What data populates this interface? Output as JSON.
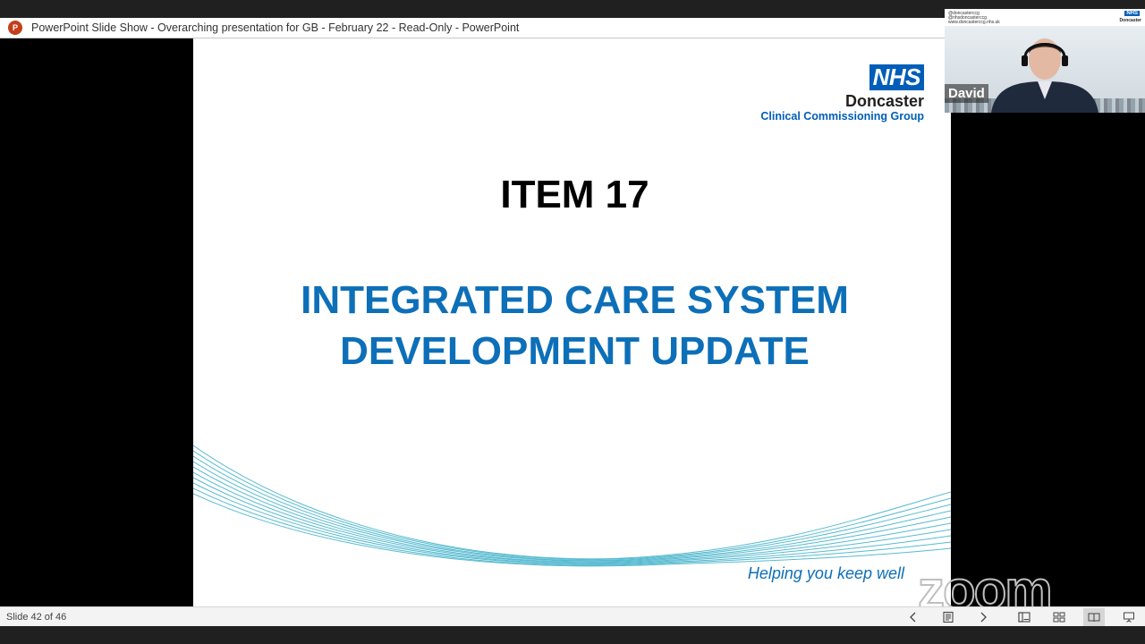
{
  "window": {
    "title": "PowerPoint Slide Show  -  Overarching presentation for GB - February 22  -  Read-Only - PowerPoint",
    "app_icon": "powerpoint-icon",
    "app_icon_letter": "P"
  },
  "slide": {
    "logo": {
      "nhs": "NHS",
      "org": "Doncaster",
      "group": "Clinical Commissioning Group"
    },
    "item_title": "ITEM 17",
    "main_title_line1": "INTEGRATED CARE SYSTEM",
    "main_title_line2": "DEVELOPMENT UPDATE",
    "tagline": "Helping you keep well"
  },
  "video": {
    "participant_name": "David",
    "banner_line1": "@doncasterccg",
    "banner_line2": "@nhsdoncasterccg",
    "banner_line3": "www.doncasterccg.nhs.uk",
    "banner_nhs": "NHS",
    "banner_org": "Doncaster"
  },
  "watermark": "zoom",
  "statusbar": {
    "slide_counter": "Slide 42 of 46",
    "icons": [
      "previous-icon",
      "notes-icon",
      "next-icon",
      "normal-view-icon",
      "slide-sorter-icon",
      "reading-view-icon",
      "slideshow-icon"
    ]
  },
  "colors": {
    "nhs_blue": "#005eb8",
    "title_blue": "#0d6fb8",
    "wave_teal": "#3aafc8"
  }
}
